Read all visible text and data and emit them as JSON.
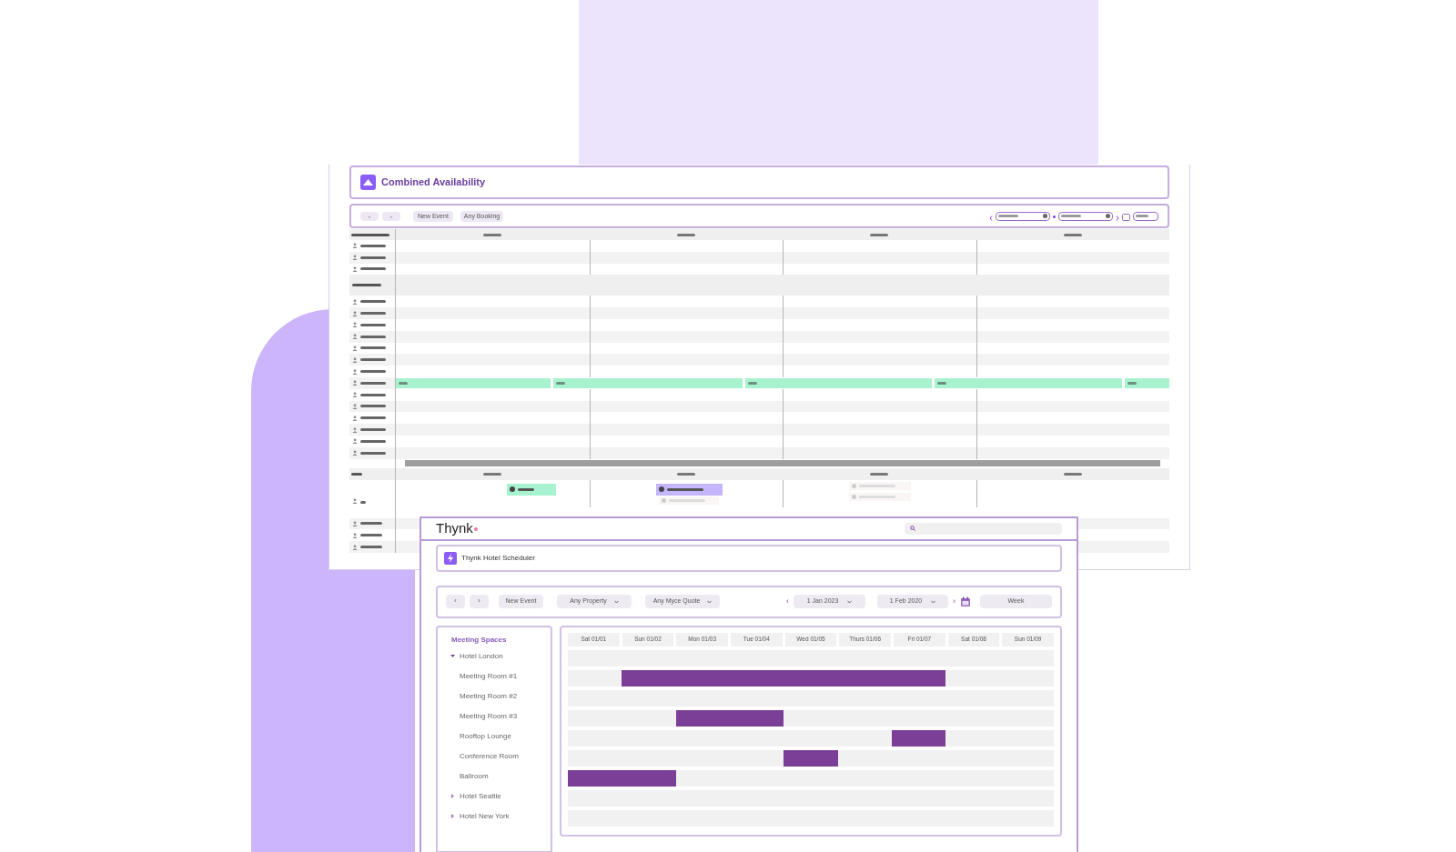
{
  "back_window": {
    "title": "Combined Availability",
    "toolbar": {
      "nav": [
        "‹",
        "›"
      ],
      "new_event": "New Event",
      "filter": "Any Booking"
    },
    "rows": [
      {
        "kind": "resource"
      },
      {
        "kind": "resource"
      },
      {
        "kind": "resource"
      },
      {
        "kind": "group"
      },
      {
        "kind": "resource"
      },
      {
        "kind": "resource"
      },
      {
        "kind": "resource"
      },
      {
        "kind": "resource"
      },
      {
        "kind": "resource"
      },
      {
        "kind": "resource"
      },
      {
        "kind": "resource"
      },
      {
        "kind": "available"
      },
      {
        "kind": "resource"
      },
      {
        "kind": "resource"
      },
      {
        "kind": "resource"
      },
      {
        "kind": "resource"
      },
      {
        "kind": "resource"
      },
      {
        "kind": "resource"
      }
    ]
  },
  "front_window": {
    "brand": "Thynk",
    "title": "Thynk Hotel Scheduler",
    "toolbar": {
      "nav": [
        "‹",
        "›"
      ],
      "new_event": "New Event",
      "filters": [
        "Any Property",
        "Any Myce Quote"
      ],
      "prev": "‹",
      "start": "1 Jan 2023",
      "end": "1 Feb 2020",
      "next": "›",
      "view": "Week"
    },
    "sidebar": {
      "heading": "Meeting Spaces",
      "tree": [
        {
          "label": "Hotel London",
          "expanded": true,
          "children": [
            {
              "label": "Meeting Room #1"
            },
            {
              "label": "Meeting Room #2"
            },
            {
              "label": "Meeting Room #3"
            },
            {
              "label": "Rooftop Lounge"
            },
            {
              "label": "Conference Room"
            },
            {
              "label": "Ballroom"
            }
          ]
        },
        {
          "label": "Hotel Seattle",
          "expanded": false
        },
        {
          "label": "Hotel New York",
          "expanded": false
        }
      ]
    },
    "grid": {
      "days": [
        "Sat 01/01",
        "Sun 01/02",
        "Mon 01/03",
        "Tue 01/04",
        "Wed 01/05",
        "Thurs 01/06",
        "Fri 01/07",
        "Sat 01/08",
        "Sun 01/09"
      ],
      "rows": [
        {
          "cells": [
            false,
            false,
            false,
            false,
            false,
            false,
            false,
            false,
            false
          ]
        },
        {
          "cells": [
            false,
            true,
            true,
            true,
            true,
            true,
            true,
            false,
            false
          ]
        },
        {
          "cells": [
            false,
            false,
            false,
            false,
            false,
            false,
            false,
            false,
            false
          ]
        },
        {
          "cells": [
            false,
            false,
            true,
            true,
            false,
            false,
            false,
            false,
            false
          ]
        },
        {
          "cells": [
            false,
            false,
            false,
            false,
            false,
            false,
            true,
            false,
            false
          ]
        },
        {
          "cells": [
            false,
            false,
            false,
            false,
            true,
            false,
            false,
            false,
            false
          ]
        },
        {
          "cells": [
            true,
            true,
            false,
            false,
            false,
            false,
            false,
            false,
            false
          ]
        },
        {
          "cells": [
            false,
            false,
            false,
            false,
            false,
            false,
            false,
            false,
            false
          ]
        },
        {
          "cells": [
            false,
            false,
            false,
            false,
            false,
            false,
            false,
            false,
            false
          ]
        }
      ]
    }
  }
}
